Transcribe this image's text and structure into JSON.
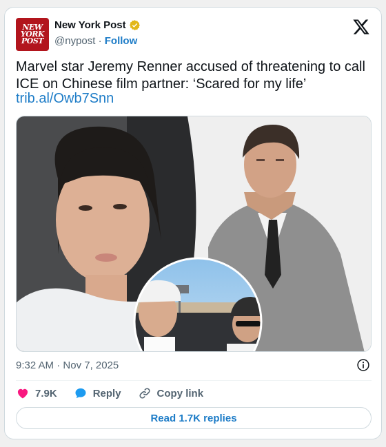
{
  "colors": {
    "accent": "#1d7cc7",
    "brand": "#b2151d",
    "heart": "#f91880",
    "secondary_text": "#536471"
  },
  "account": {
    "logo_lines": [
      "NEW",
      "YORK",
      "POST"
    ],
    "name": "New York Post",
    "verified_icon": "gold-verified-badge-icon",
    "handle": "@nypost",
    "separator": " · ",
    "follow_label": "Follow"
  },
  "platform_icon": "x-logo-icon",
  "tweet": {
    "text": "Marvel star Jeremy Renner accused of threatening to call ICE on Chinese film partner: ‘Scared for my life’",
    "link": "trib.al/Owb7Snn"
  },
  "media": {
    "panels": [
      "woman-selfie-photo",
      "jeremy-renner-portrait-photo",
      "couple-car-selfie-inset-photo"
    ]
  },
  "meta": {
    "time": "9:32 AM",
    "separator": " · ",
    "date": "Nov 7, 2025",
    "info_icon": "info-icon"
  },
  "actions": {
    "like_count": "7.9K",
    "like_icon": "heart-icon",
    "reply_label": "Reply",
    "reply_icon": "speech-bubble-icon",
    "copy_label": "Copy link",
    "copy_icon": "link-icon"
  },
  "read_replies_label": "Read 1.7K replies"
}
